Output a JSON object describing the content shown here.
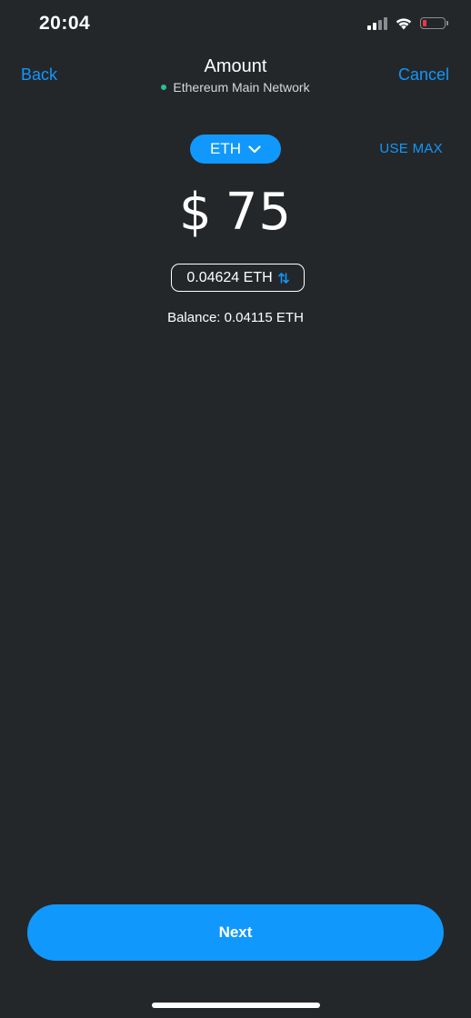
{
  "status_bar": {
    "time": "20:04",
    "icons": [
      "cellular-signal-icon",
      "wifi-icon",
      "battery-low-icon"
    ]
  },
  "header": {
    "back_label": "Back",
    "title": "Amount",
    "network_name": "Ethereum Main Network",
    "cancel_label": "Cancel"
  },
  "asset": {
    "symbol": "ETH",
    "use_max_label": "USE MAX"
  },
  "amount": {
    "currency_symbol": "$",
    "value": "75"
  },
  "conversion": {
    "text": "0.04624 ETH"
  },
  "balance": {
    "text": "Balance: 0.04115 ETH"
  },
  "footer": {
    "next_label": "Next"
  },
  "colors": {
    "background": "#24272a",
    "accent": "#1098fc",
    "network_dot": "#28c19a",
    "battery_low": "#ea3943"
  }
}
